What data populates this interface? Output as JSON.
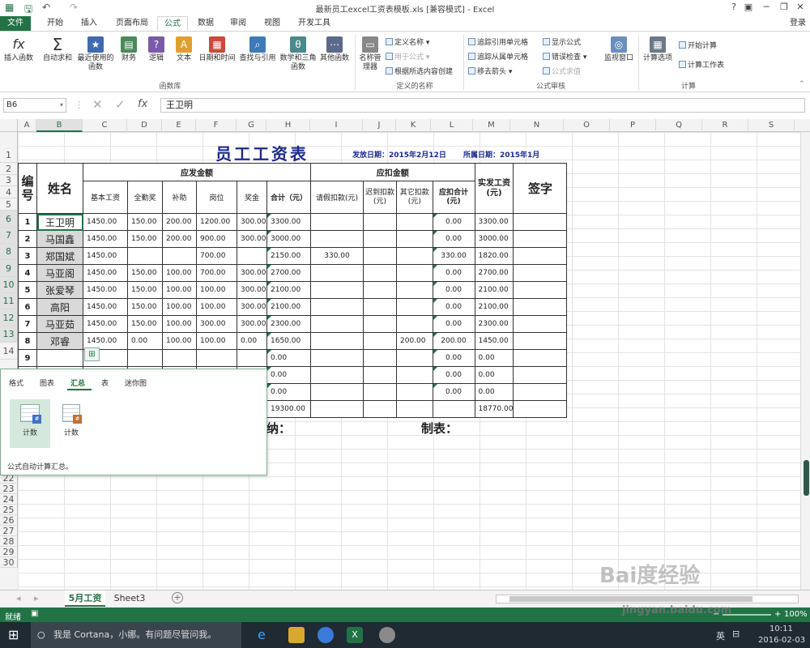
{
  "window": {
    "title": "最新员工excel工资表模板.xls  [兼容模式] - Excel",
    "help": "?",
    "login": "登录"
  },
  "tabs": [
    "文件",
    "开始",
    "插入",
    "页面布局",
    "公式",
    "数据",
    "审阅",
    "视图",
    "开发工具"
  ],
  "ribbon": {
    "library": {
      "insert_fn": "插入函数",
      "autosum": "自动求和",
      "recent": "最近使用的函数",
      "finance": "财务",
      "logic": "逻辑",
      "text": "文本",
      "datetime": "日期和时间",
      "lookup": "查找与引用",
      "math": "数学和三角函数",
      "other": "其他函数",
      "group_label": "函数库"
    },
    "names": {
      "name_mgr": "名称管理器",
      "define": "定义名称",
      "use_in": "用于公式",
      "create_sel": "根据所选内容创建",
      "group_label": "定义的名称"
    },
    "audit": {
      "trace_prec": "追踪引用单元格",
      "trace_dep": "追踪从属单元格",
      "remove_arrows": "移去箭头",
      "show_formulas": "显示公式",
      "error_check": "错误检查",
      "eval": "公式求值",
      "watch": "监视窗口",
      "group_label": "公式审核"
    },
    "calc": {
      "options": "计算选项",
      "calc_now": "开始计算",
      "calc_sheet": "计算工作表",
      "group_label": "计算"
    }
  },
  "formula_bar": {
    "name_box": "B6",
    "fx": "fx",
    "content": "王卫明"
  },
  "columns": [
    "A",
    "B",
    "C",
    "D",
    "E",
    "F",
    "G",
    "H",
    "I",
    "J",
    "K",
    "L",
    "M",
    "N",
    "O",
    "P",
    "Q",
    "R",
    "S"
  ],
  "rows": [
    "1",
    "2",
    "3",
    "4",
    "5",
    "6",
    "7",
    "8",
    "9",
    "10",
    "11",
    "12",
    "13",
    "14",
    "",
    "",
    "",
    "",
    "",
    "",
    "",
    "22",
    "23",
    "24",
    "25",
    "26",
    "27",
    "28",
    "29",
    "30"
  ],
  "sheet": {
    "title": "员工工资表",
    "issue_date": "发放日期：2015年2月12日",
    "period": "所属日期：2015年1月",
    "headers": {
      "no": "编号",
      "name": "姓名",
      "payable": "应发金额",
      "base": "基本工资",
      "attendance": "全勤奖",
      "subsidy": "补助",
      "post": "岗位",
      "bonus": "奖金",
      "total": "合计（元）",
      "deduct": "应扣金额",
      "leave": "请假扣款(元)",
      "late": "迟到扣款(元)",
      "other": "其它扣款(元)",
      "deduct_total": "应扣合计(元)",
      "actual": "实发工资(元)",
      "sign": "签字"
    },
    "employees": [
      {
        "no": "1",
        "name": "王卫明",
        "base": "1450.00",
        "attendance": "150.00",
        "subsidy": "200.00",
        "post": "1200.00",
        "bonus": "300.00",
        "total": "3300.00",
        "leave": "",
        "late": "",
        "other": "",
        "deduct_total": "0.00",
        "actual": "3300.00"
      },
      {
        "no": "2",
        "name": "马国鑫",
        "base": "1450.00",
        "attendance": "150.00",
        "subsidy": "200.00",
        "post": "900.00",
        "bonus": "300.00",
        "total": "3000.00",
        "leave": "",
        "late": "",
        "other": "",
        "deduct_total": "0.00",
        "actual": "3000.00"
      },
      {
        "no": "3",
        "name": "郑国斌",
        "base": "1450.00",
        "attendance": "",
        "subsidy": "",
        "post": "700.00",
        "bonus": "",
        "total": "2150.00",
        "leave": "330.00",
        "late": "",
        "other": "",
        "deduct_total": "330.00",
        "actual": "1820.00"
      },
      {
        "no": "4",
        "name": "马亚阁",
        "base": "1450.00",
        "attendance": "150.00",
        "subsidy": "100.00",
        "post": "700.00",
        "bonus": "300.00",
        "total": "2700.00",
        "leave": "",
        "late": "",
        "other": "",
        "deduct_total": "0.00",
        "actual": "2700.00"
      },
      {
        "no": "5",
        "name": "张爱琴",
        "base": "1450.00",
        "attendance": "150.00",
        "subsidy": "100.00",
        "post": "100.00",
        "bonus": "300.00",
        "total": "2100.00",
        "leave": "",
        "late": "",
        "other": "",
        "deduct_total": "0.00",
        "actual": "2100.00"
      },
      {
        "no": "6",
        "name": "高阳",
        "base": "1450.00",
        "attendance": "150.00",
        "subsidy": "100.00",
        "post": "100.00",
        "bonus": "300.00",
        "total": "2100.00",
        "leave": "",
        "late": "",
        "other": "",
        "deduct_total": "0.00",
        "actual": "2100.00"
      },
      {
        "no": "7",
        "name": "马亚茹",
        "base": "1450.00",
        "attendance": "150.00",
        "subsidy": "100.00",
        "post": "300.00",
        "bonus": "300.00",
        "total": "2300.00",
        "leave": "",
        "late": "",
        "other": "",
        "deduct_total": "0.00",
        "actual": "2300.00"
      },
      {
        "no": "8",
        "name": "邓睿",
        "base": "1450.00",
        "attendance": "0.00",
        "subsidy": "100.00",
        "post": "100.00",
        "bonus": "0.00",
        "total": "1650.00",
        "leave": "",
        "late": "",
        "other": "200.00",
        "deduct_total": "200.00",
        "actual": "1450.00"
      }
    ],
    "row9_no": "9",
    "zero": "0.00",
    "sum_total": "19300.00",
    "sum_actual": "18770.00",
    "cashier": "纳：",
    "preparer": "制表："
  },
  "quick_analysis": {
    "tabs": [
      "格式",
      "图表",
      "汇总",
      "表",
      "迷你图"
    ],
    "active_tab": "汇总",
    "items": [
      "计数",
      "计数"
    ],
    "description": "公式自动计算汇总。"
  },
  "sheets": [
    "5月工资",
    "Sheet3"
  ],
  "active_sheet": "5月工资",
  "status": {
    "ready": "就绪",
    "zoom": "100%"
  },
  "taskbar": {
    "cortana": "我是 Cortana，小娜。有问题尽管问我。",
    "ime": "英",
    "time": "10:11",
    "date": "2016-02-03"
  },
  "watermark": {
    "brand": "Bai度经验",
    "url": "jingyan.baidu.com"
  },
  "colors": {
    "accent": "#217346",
    "title_blue": "#1c2a8c"
  }
}
